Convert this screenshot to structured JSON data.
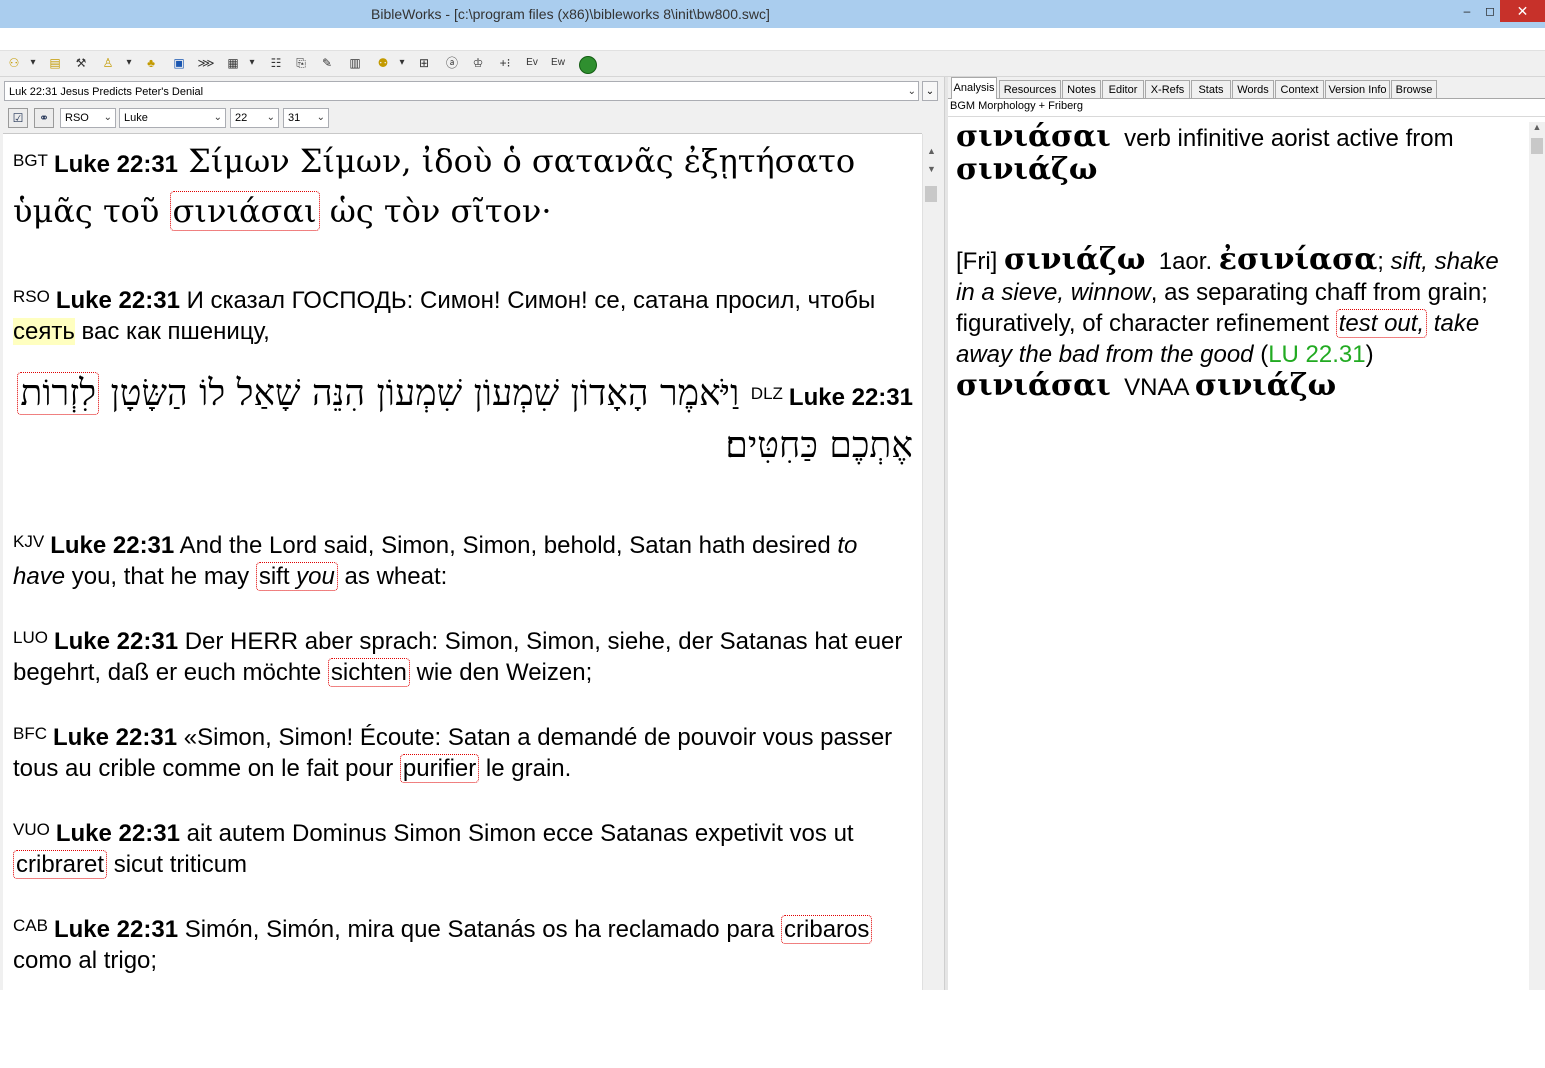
{
  "window": {
    "title": "BibleWorks - [c:\\program files (x86)\\bibleworks 8\\init\\bw800.swc]",
    "min_label": "–",
    "max_label": "◻",
    "close_label": "✕"
  },
  "toolbar": {
    "icons": [
      "users-icon",
      "user-check-icon",
      "tools-icon",
      "user-down-icon",
      "bell-icon",
      "windows-icon",
      "arrows-icon",
      "grid-icon",
      "columns-icon",
      "copy-icon",
      "edit-icon",
      "printer-icon",
      "users-up-icon",
      "layout-icon",
      "text-icon",
      "search-user-icon",
      "plus-lines-icon",
      "ev-icon",
      "ew-icon",
      "globe-icon"
    ],
    "glyphs": {
      "users": "⚇",
      "drop": "▾",
      "userCheck": "▤",
      "tools": "⚒",
      "userDown": "♙",
      "bell": "♣",
      "windows": "▣",
      "arrows": "⋙",
      "grid": "▦",
      "columns": "☷",
      "copy": "⎘",
      "edit": "✎",
      "printer": "▥",
      "usersUp": "⚉",
      "layout": "⊞",
      "text": "ⓐ",
      "searchUser": "♔",
      "plusLines": "+⁝",
      "ev": "Ev",
      "ew": "Ew"
    }
  },
  "search": {
    "reference": "Luk 22:31 Jesus Predicts Peter's Denial",
    "version": "RSO",
    "book": "Luke",
    "chapter": "22",
    "verse": "31",
    "arrow": "⌄",
    "check_glyph": "☑",
    "link_glyph": "⚭"
  },
  "verses": [
    {
      "version": "BGT",
      "ref": "Luke 22:31",
      "before": "Σίμων Σίμων, ἰδοὺ ὁ σατανᾶς ἐξῃτήσατο ὑμᾶς τοῦ",
      "highlight": "σινιάσαι",
      "after": "ὡς τὸν σῖτον·"
    },
    {
      "version": "RSO",
      "ref": "Luke 22:31",
      "before": "И сказал ГОСПОДЬ: Симон! Симон! се, сатана просил, чтобы",
      "highlight": "сеять",
      "after": "вас как пшеницу,"
    },
    {
      "version": "DLZ",
      "ref": "Luke 22:31",
      "before": "וַיֹּאמֶר הָאָדוֹן שִׁמְעוֹן שִׁמְעוֹן הִנֵּה שָׁאַל לוֹ הַשָּׂטָן",
      "highlight": "לִזְרוֹת",
      "after": "אֶתְכֶם כַּחִטִּים׃"
    },
    {
      "version": "KJV",
      "ref": "Luke 22:31",
      "before": "And the Lord said, Simon, Simon, behold, Satan hath desired",
      "italic1": "to have",
      "mid": "you, that he may",
      "highlight": "sift",
      "highlight_italic": "you",
      "after": "as wheat:"
    },
    {
      "version": "LUO",
      "ref": "Luke 22:31",
      "before": "Der HERR aber sprach: Simon, Simon, siehe, der Satanas hat euer begehrt, daß er euch möchte",
      "highlight": "sichten",
      "after": "wie den Weizen;"
    },
    {
      "version": "BFC",
      "ref": "Luke 22:31",
      "before": "«Simon, Simon! Écoute: Satan a demandé de pouvoir vous passer tous au crible comme on le fait pour",
      "highlight": "purifier",
      "after": "le grain."
    },
    {
      "version": "VUO",
      "ref": "Luke 22:31",
      "before": "ait autem Dominus Simon Simon ecce Satanas expetivit vos ut",
      "highlight": "cribraret",
      "after": "sicut triticum"
    },
    {
      "version": "CAB",
      "ref": "Luke 22:31",
      "before": "Simón, Simón, mira que Satanás os ha reclamado para",
      "highlight": "cribaros",
      "after": "como al trigo;"
    }
  ],
  "tabs": [
    "Analysis",
    "Resources",
    "Notes",
    "Editor",
    "X-Refs",
    "Stats",
    "Words",
    "Context",
    "Version Info",
    "Browse"
  ],
  "analysis": {
    "module": "BGM Morphology + Friberg",
    "word": "σινιάσαι",
    "parse": "verb infinitive aorist active from",
    "lemma": "σινιάζω",
    "fri_tag": "[Fri]",
    "fri_lemma": "σινιάζω",
    "aor_label": "1aor.",
    "aor_form": "ἐσινίασα",
    "sep": ";",
    "def1": "sift, shake in a sieve, winnow",
    "def2": ", as separating chaff from grain; figuratively, of character refinement",
    "def3_boxed": "test out,",
    "def4": "take away the bad from the good",
    "open_paren": "(",
    "ref": "LU 22.31",
    "close_paren": ")",
    "word2": "σινιάσαι",
    "code": "VNAA",
    "lemma2": "σινιάζω"
  },
  "scroll": {
    "up": "▲",
    "down": "▼"
  },
  "colors": {
    "titlebar": "#aacdee",
    "close": "#c7312a",
    "highlight": "#ffffc0",
    "box_border": "#e00000",
    "link_green": "#22aa22"
  }
}
